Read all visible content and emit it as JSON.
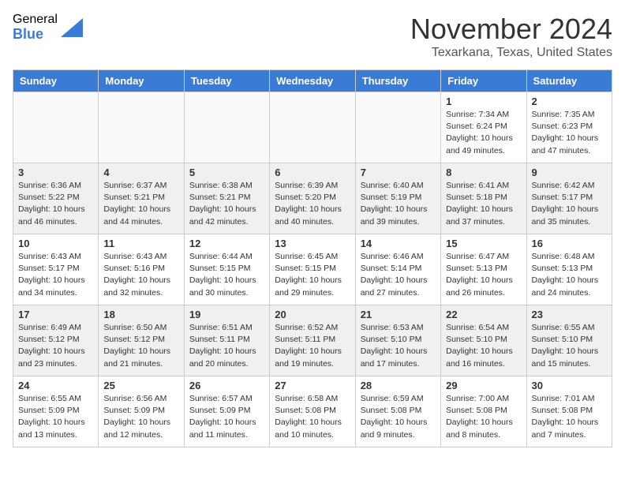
{
  "logo": {
    "general": "General",
    "blue": "Blue"
  },
  "header": {
    "month": "November 2024",
    "location": "Texarkana, Texas, United States"
  },
  "weekdays": [
    "Sunday",
    "Monday",
    "Tuesday",
    "Wednesday",
    "Thursday",
    "Friday",
    "Saturday"
  ],
  "weeks": [
    [
      {
        "day": "",
        "info": ""
      },
      {
        "day": "",
        "info": ""
      },
      {
        "day": "",
        "info": ""
      },
      {
        "day": "",
        "info": ""
      },
      {
        "day": "",
        "info": ""
      },
      {
        "day": "1",
        "info": "Sunrise: 7:34 AM\nSunset: 6:24 PM\nDaylight: 10 hours\nand 49 minutes."
      },
      {
        "day": "2",
        "info": "Sunrise: 7:35 AM\nSunset: 6:23 PM\nDaylight: 10 hours\nand 47 minutes."
      }
    ],
    [
      {
        "day": "3",
        "info": "Sunrise: 6:36 AM\nSunset: 5:22 PM\nDaylight: 10 hours\nand 46 minutes."
      },
      {
        "day": "4",
        "info": "Sunrise: 6:37 AM\nSunset: 5:21 PM\nDaylight: 10 hours\nand 44 minutes."
      },
      {
        "day": "5",
        "info": "Sunrise: 6:38 AM\nSunset: 5:21 PM\nDaylight: 10 hours\nand 42 minutes."
      },
      {
        "day": "6",
        "info": "Sunrise: 6:39 AM\nSunset: 5:20 PM\nDaylight: 10 hours\nand 40 minutes."
      },
      {
        "day": "7",
        "info": "Sunrise: 6:40 AM\nSunset: 5:19 PM\nDaylight: 10 hours\nand 39 minutes."
      },
      {
        "day": "8",
        "info": "Sunrise: 6:41 AM\nSunset: 5:18 PM\nDaylight: 10 hours\nand 37 minutes."
      },
      {
        "day": "9",
        "info": "Sunrise: 6:42 AM\nSunset: 5:17 PM\nDaylight: 10 hours\nand 35 minutes."
      }
    ],
    [
      {
        "day": "10",
        "info": "Sunrise: 6:43 AM\nSunset: 5:17 PM\nDaylight: 10 hours\nand 34 minutes."
      },
      {
        "day": "11",
        "info": "Sunrise: 6:43 AM\nSunset: 5:16 PM\nDaylight: 10 hours\nand 32 minutes."
      },
      {
        "day": "12",
        "info": "Sunrise: 6:44 AM\nSunset: 5:15 PM\nDaylight: 10 hours\nand 30 minutes."
      },
      {
        "day": "13",
        "info": "Sunrise: 6:45 AM\nSunset: 5:15 PM\nDaylight: 10 hours\nand 29 minutes."
      },
      {
        "day": "14",
        "info": "Sunrise: 6:46 AM\nSunset: 5:14 PM\nDaylight: 10 hours\nand 27 minutes."
      },
      {
        "day": "15",
        "info": "Sunrise: 6:47 AM\nSunset: 5:13 PM\nDaylight: 10 hours\nand 26 minutes."
      },
      {
        "day": "16",
        "info": "Sunrise: 6:48 AM\nSunset: 5:13 PM\nDaylight: 10 hours\nand 24 minutes."
      }
    ],
    [
      {
        "day": "17",
        "info": "Sunrise: 6:49 AM\nSunset: 5:12 PM\nDaylight: 10 hours\nand 23 minutes."
      },
      {
        "day": "18",
        "info": "Sunrise: 6:50 AM\nSunset: 5:12 PM\nDaylight: 10 hours\nand 21 minutes."
      },
      {
        "day": "19",
        "info": "Sunrise: 6:51 AM\nSunset: 5:11 PM\nDaylight: 10 hours\nand 20 minutes."
      },
      {
        "day": "20",
        "info": "Sunrise: 6:52 AM\nSunset: 5:11 PM\nDaylight: 10 hours\nand 19 minutes."
      },
      {
        "day": "21",
        "info": "Sunrise: 6:53 AM\nSunset: 5:10 PM\nDaylight: 10 hours\nand 17 minutes."
      },
      {
        "day": "22",
        "info": "Sunrise: 6:54 AM\nSunset: 5:10 PM\nDaylight: 10 hours\nand 16 minutes."
      },
      {
        "day": "23",
        "info": "Sunrise: 6:55 AM\nSunset: 5:10 PM\nDaylight: 10 hours\nand 15 minutes."
      }
    ],
    [
      {
        "day": "24",
        "info": "Sunrise: 6:55 AM\nSunset: 5:09 PM\nDaylight: 10 hours\nand 13 minutes."
      },
      {
        "day": "25",
        "info": "Sunrise: 6:56 AM\nSunset: 5:09 PM\nDaylight: 10 hours\nand 12 minutes."
      },
      {
        "day": "26",
        "info": "Sunrise: 6:57 AM\nSunset: 5:09 PM\nDaylight: 10 hours\nand 11 minutes."
      },
      {
        "day": "27",
        "info": "Sunrise: 6:58 AM\nSunset: 5:08 PM\nDaylight: 10 hours\nand 10 minutes."
      },
      {
        "day": "28",
        "info": "Sunrise: 6:59 AM\nSunset: 5:08 PM\nDaylight: 10 hours\nand 9 minutes."
      },
      {
        "day": "29",
        "info": "Sunrise: 7:00 AM\nSunset: 5:08 PM\nDaylight: 10 hours\nand 8 minutes."
      },
      {
        "day": "30",
        "info": "Sunrise: 7:01 AM\nSunset: 5:08 PM\nDaylight: 10 hours\nand 7 minutes."
      }
    ]
  ]
}
